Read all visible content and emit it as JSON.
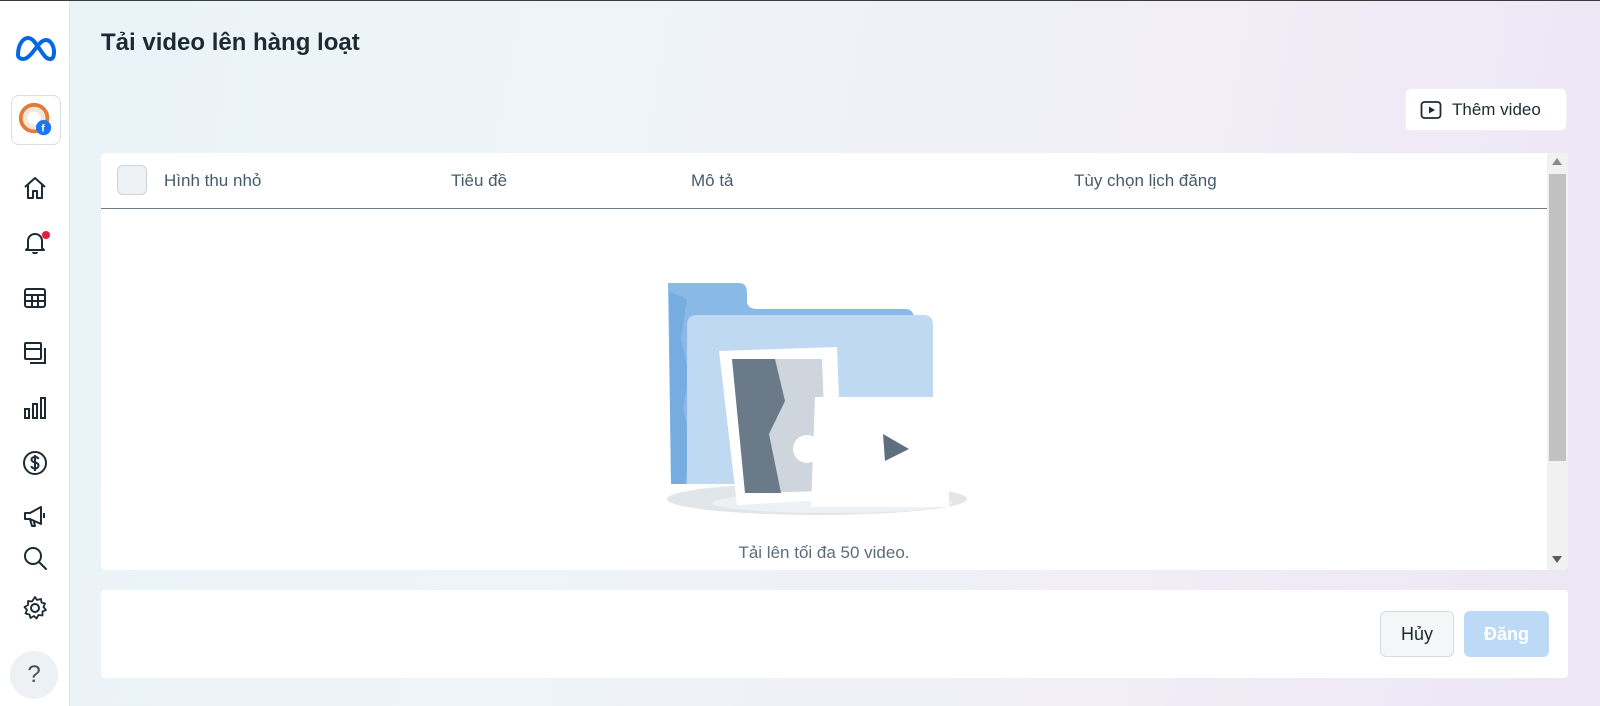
{
  "page": {
    "title": "Tải video lên hàng loạt"
  },
  "toolbar": {
    "add_video_label": "Thêm video"
  },
  "table": {
    "columns": [
      "Hình thu nhỏ",
      "Tiêu đề",
      "Mô tả",
      "Tùy chọn lịch đăng"
    ],
    "empty_message": "Tải lên tối đa 50 video."
  },
  "footer": {
    "cancel_label": "Hủy",
    "post_label": "Đăng"
  },
  "sidebar": {
    "items": [
      {
        "icon": "home-icon"
      },
      {
        "icon": "bell-icon",
        "has_notification": true
      },
      {
        "icon": "table-icon"
      },
      {
        "icon": "pages-icon"
      },
      {
        "icon": "insights-icon"
      },
      {
        "icon": "dollar-icon"
      },
      {
        "icon": "megaphone-icon"
      },
      {
        "icon": "search-icon"
      },
      {
        "icon": "gear-icon"
      }
    ],
    "help_label": "?"
  },
  "colors": {
    "accent_disabled": "#bcd9f5",
    "notification": "#e41e3f",
    "meta_blue": "#0668e1"
  }
}
